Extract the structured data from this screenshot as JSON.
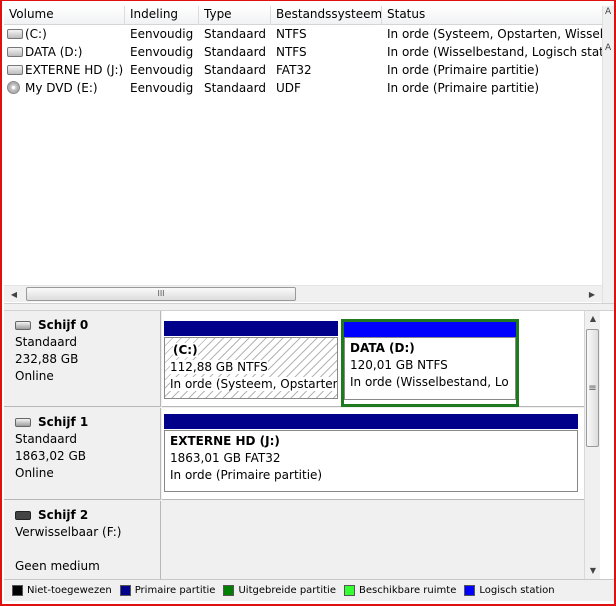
{
  "columns": [
    "Volume",
    "Indeling",
    "Type",
    "Bestandssysteem",
    "Status"
  ],
  "volumes": [
    {
      "volume": "(C:)",
      "layout": "Eenvoudig",
      "type": "Standaard",
      "fs": "NTFS",
      "status": "In orde (Systeem, Opstarten, Wisselb",
      "icon": "hard-drive-icon"
    },
    {
      "volume": "DATA (D:)",
      "layout": "Eenvoudig",
      "type": "Standaard",
      "fs": "NTFS",
      "status": "In orde (Wisselbestand, Logisch stati",
      "icon": "hard-drive-icon"
    },
    {
      "volume": "EXTERNE HD (J:)",
      "layout": "Eenvoudig",
      "type": "Standaard",
      "fs": "FAT32",
      "status": "In orde (Primaire partitie)",
      "icon": "hard-drive-icon"
    },
    {
      "volume": "My DVD (E:)",
      "layout": "Eenvoudig",
      "type": "Standaard",
      "fs": "UDF",
      "status": "In orde (Primaire partitie)",
      "icon": "dvd-icon"
    }
  ],
  "right_strip": {
    "top": "A",
    "mid": "A"
  },
  "hscroll_grip": "III",
  "vscroll_grip": "≡",
  "disks": [
    {
      "name": "Schijf 0",
      "kind": "Standaard",
      "size": "232,88 GB",
      "state": "Online",
      "partitions": [
        {
          "name": "(C:)",
          "size_fs": "112,88 GB NTFS",
          "status": "In orde (Systeem, Opstarten",
          "color": "#00008b",
          "hatched": true
        },
        {
          "name": "DATA  (D:)",
          "size_fs": "120,01 GB NTFS",
          "status": "In orde (Wisselbestand, Lo",
          "color": "#0000ff",
          "selected": true
        }
      ]
    },
    {
      "name": "Schijf 1",
      "kind": "Standaard",
      "size": "1863,02 GB",
      "state": "Online",
      "partitions": [
        {
          "name": "EXTERNE HD  (J:)",
          "size_fs": "1863,01 GB FAT32",
          "status": "In orde (Primaire partitie)",
          "color": "#00008b"
        }
      ]
    },
    {
      "name": "Schijf 2",
      "kind": "Verwisselbaar (F:)",
      "size": "",
      "state": "Geen medium",
      "partitions": []
    }
  ],
  "legend": [
    {
      "label": "Niet-toegewezen",
      "color": "#000000"
    },
    {
      "label": "Primaire partitie",
      "color": "#00008b"
    },
    {
      "label": "Uitgebreide partitie",
      "color": "#008000"
    },
    {
      "label": "Beschikbare ruimte",
      "color": "#33ff33"
    },
    {
      "label": "Logisch station",
      "color": "#0000ff"
    }
  ]
}
